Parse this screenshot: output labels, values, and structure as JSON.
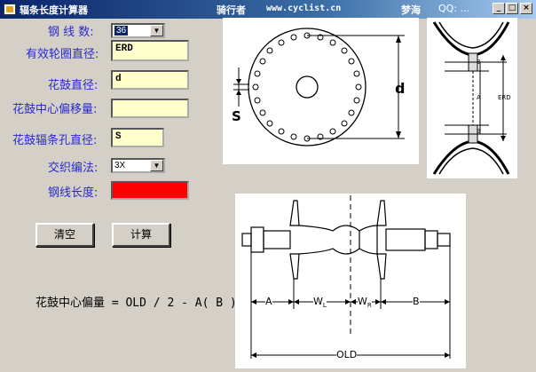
{
  "window": {
    "title": "辐条长度计算器",
    "rider": "骑行者",
    "site": "www.cyclist.cn",
    "author": "梦海",
    "qq": "QQ: ...",
    "buttons": {
      "minimize": "_",
      "maximize": "□",
      "close": "×"
    }
  },
  "form": {
    "spoke_count_label": "钢 线 数:",
    "spoke_count_value": "36",
    "erd_label": "有效轮圈直径:",
    "erd_value": "ERD",
    "hub_diameter_label": "花鼓直径:",
    "hub_diameter_value": "d",
    "hub_offset_label": "花鼓中心偏移量:",
    "hub_offset_value": "",
    "spoke_hole_label": "花鼓辐条孔直径:",
    "spoke_hole_value": "S",
    "cross_label": "交织编法:",
    "cross_value": "3X",
    "length_label": "钢线长度:",
    "result_color": "#ff0000"
  },
  "actions": {
    "clear_label": "清空",
    "calc_label": "计算"
  },
  "formula": "花鼓中心偏量 = OLD / 2 - A( B )",
  "diagrams": {
    "flange": {
      "diameter_label": "d",
      "hole_label": "S"
    },
    "rim": {
      "label_a": "A",
      "label_b": "B",
      "label_erd": "ERD"
    },
    "hub": {
      "label_a": "A",
      "label_wl": "W",
      "label_wl_sub": "L",
      "label_wr": "W",
      "label_wr_sub": "R",
      "label_b": "B",
      "label_old": "OLD"
    }
  }
}
